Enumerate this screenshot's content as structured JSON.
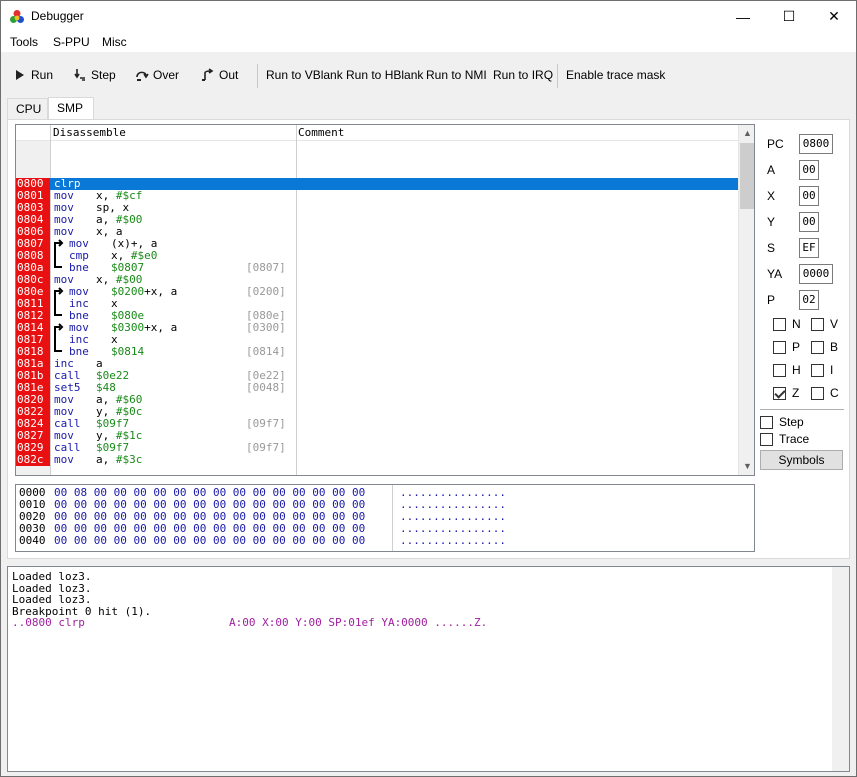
{
  "window": {
    "title": "Debugger",
    "minimize": "—",
    "maximize": "☐",
    "close": "✕"
  },
  "menu": {
    "tools": "Tools",
    "sppu": "S-PPU",
    "misc": "Misc"
  },
  "toolbar": {
    "run": "Run",
    "step": "Step",
    "over": "Over",
    "out": "Out",
    "run_vblank": "Run to VBlank",
    "run_hblank": "Run to HBlank",
    "run_nmi": "Run to NMI",
    "run_irq": "Run to IRQ",
    "trace_mask": "Enable trace mask"
  },
  "tabs": {
    "cpu": "CPU",
    "smp": "SMP"
  },
  "disassembly": {
    "col_disassemble": "Disassemble",
    "col_comment": "Comment",
    "rows": [
      {
        "addr": "0800",
        "mn": "clrp",
        "op": "",
        "cm": "",
        "sel": true
      },
      {
        "addr": "0801",
        "mn": "mov",
        "op": "x, #$cf",
        "cm": ""
      },
      {
        "addr": "0803",
        "mn": "mov",
        "op": "sp, x",
        "cm": ""
      },
      {
        "addr": "0804",
        "mn": "mov",
        "op": "a, #$00",
        "cm": ""
      },
      {
        "addr": "0806",
        "mn": "mov",
        "op": "x, a",
        "cm": ""
      },
      {
        "addr": "0807",
        "mn": "mov",
        "op": "(x)+, a",
        "cm": ""
      },
      {
        "addr": "0808",
        "mn": "cmp",
        "op": "x, #$e0",
        "cm": ""
      },
      {
        "addr": "080a",
        "mn": "bne",
        "op": "$0807",
        "cm": "[0807]"
      },
      {
        "addr": "080c",
        "mn": "mov",
        "op": "x, #$00",
        "cm": ""
      },
      {
        "addr": "080e",
        "mn": "mov",
        "op": "$0200+x, a",
        "cm": "[0200]"
      },
      {
        "addr": "0811",
        "mn": "inc",
        "op": "x",
        "cm": ""
      },
      {
        "addr": "0812",
        "mn": "bne",
        "op": "$080e",
        "cm": "[080e]"
      },
      {
        "addr": "0814",
        "mn": "mov",
        "op": "$0300+x, a",
        "cm": "[0300]"
      },
      {
        "addr": "0817",
        "mn": "inc",
        "op": "x",
        "cm": ""
      },
      {
        "addr": "0818",
        "mn": "bne",
        "op": "$0814",
        "cm": "[0814]"
      },
      {
        "addr": "081a",
        "mn": "inc",
        "op": "a",
        "cm": ""
      },
      {
        "addr": "081b",
        "mn": "call",
        "op": "$0e22",
        "cm": "[0e22]"
      },
      {
        "addr": "081e",
        "mn": "set5",
        "op": "$48",
        "cm": "[0048]"
      },
      {
        "addr": "0820",
        "mn": "mov",
        "op": "a, #$60",
        "cm": ""
      },
      {
        "addr": "0822",
        "mn": "mov",
        "op": "y, #$0c",
        "cm": ""
      },
      {
        "addr": "0824",
        "mn": "call",
        "op": "$09f7",
        "cm": "[09f7]"
      },
      {
        "addr": "0827",
        "mn": "mov",
        "op": "y, #$1c",
        "cm": ""
      },
      {
        "addr": "0829",
        "mn": "call",
        "op": "$09f7",
        "cm": "[09f7]"
      },
      {
        "addr": "082c",
        "mn": "mov",
        "op": "a, #$3c",
        "cm": ""
      }
    ]
  },
  "hexdump": {
    "rows": [
      {
        "addr": "0000",
        "bytes": "00 08 00 00 00 00 00 00 00 00 00 00 00 00 00 00",
        "ascii": "................"
      },
      {
        "addr": "0010",
        "bytes": "00 00 00 00 00 00 00 00 00 00 00 00 00 00 00 00",
        "ascii": "................"
      },
      {
        "addr": "0020",
        "bytes": "00 00 00 00 00 00 00 00 00 00 00 00 00 00 00 00",
        "ascii": "................"
      },
      {
        "addr": "0030",
        "bytes": "00 00 00 00 00 00 00 00 00 00 00 00 00 00 00 00",
        "ascii": "................"
      },
      {
        "addr": "0040",
        "bytes": "00 00 00 00 00 00 00 00 00 00 00 00 00 00 00 00",
        "ascii": "................"
      }
    ]
  },
  "registers": {
    "pc": {
      "label": "PC",
      "value": "0800"
    },
    "a": {
      "label": "A",
      "value": "00"
    },
    "x": {
      "label": "X",
      "value": "00"
    },
    "y": {
      "label": "Y",
      "value": "00"
    },
    "s": {
      "label": "S",
      "value": "EF"
    },
    "ya": {
      "label": "YA",
      "value": "0000"
    },
    "p": {
      "label": "P",
      "value": "02"
    }
  },
  "flags": [
    {
      "label": "N",
      "checked": false
    },
    {
      "label": "V",
      "checked": false
    },
    {
      "label": "P",
      "checked": false
    },
    {
      "label": "B",
      "checked": false
    },
    {
      "label": "H",
      "checked": false
    },
    {
      "label": "I",
      "checked": false
    },
    {
      "label": "Z",
      "checked": true
    },
    {
      "label": "C",
      "checked": false
    }
  ],
  "options": {
    "step": "Step",
    "trace": "Trace",
    "symbols": "Symbols"
  },
  "log": {
    "lines": [
      "Loaded loz3.",
      "Loaded loz3.",
      "Loaded loz3.",
      "Breakpoint 0 hit (1)."
    ],
    "trace_instr": "..0800 clrp",
    "trace_regs": "A:00 X:00 Y:00 SP:01ef YA:0000 ......Z."
  }
}
